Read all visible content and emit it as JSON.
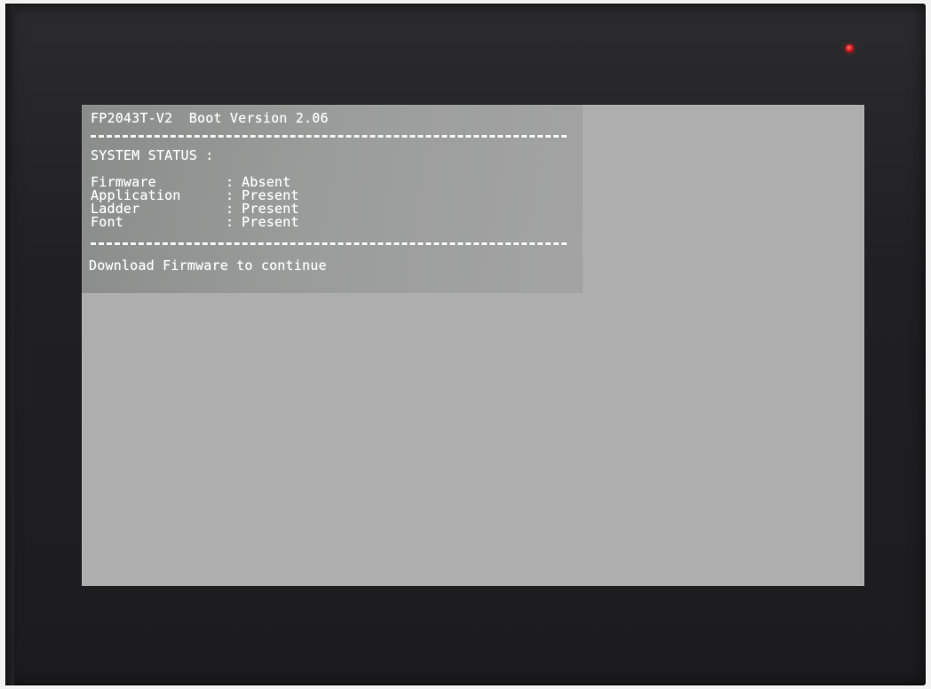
{
  "boot_screen": {
    "title": "FP2043T-V2  Boot Version 2.06",
    "status_heading": "SYSTEM STATUS :",
    "status_rows": [
      {
        "name": "Firmware",
        "separator": ":",
        "value": "Absent"
      },
      {
        "name": "Application",
        "separator": ":",
        "value": "Present"
      },
      {
        "name": "Ladder",
        "separator": ":",
        "value": "Present"
      },
      {
        "name": "Font",
        "separator": ":",
        "value": "Present"
      }
    ],
    "message": "Download Firmware to continue"
  },
  "colors": {
    "bezel": "#202022",
    "screen_background": "#aeaeae",
    "text": "#ffffff",
    "power_led": "#d40000"
  },
  "icons": {
    "power_led": "power-led-icon"
  }
}
